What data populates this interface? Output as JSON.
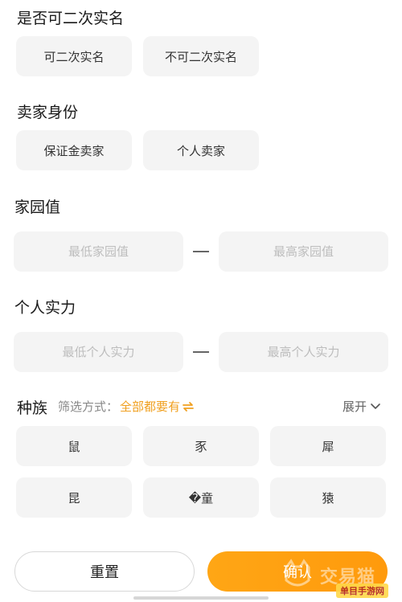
{
  "realname": {
    "title": "是否可二次实名",
    "options": [
      "可二次实名",
      "不可二次实名"
    ]
  },
  "seller": {
    "title": "卖家身份",
    "options": [
      "保证金卖家",
      "个人卖家"
    ]
  },
  "home_value": {
    "title": "家园值",
    "min_placeholder": "最低家园值",
    "max_placeholder": "最高家园值"
  },
  "power": {
    "title": "个人实力",
    "min_placeholder": "最低个人实力",
    "max_placeholder": "最高个人实力"
  },
  "race": {
    "title": "种族",
    "filter_label": "筛选方式：",
    "filter_value": "全部都要有",
    "expand_label": "展开",
    "options": [
      "鼠",
      "豕",
      "犀",
      "昆",
      "�童",
      "猿"
    ]
  },
  "footer": {
    "reset_label": "重置",
    "confirm_label": "确认"
  },
  "watermark": {
    "text": "交易猫",
    "badge": "单目手游网"
  },
  "colors": {
    "accent": "#ffa615",
    "chip_bg": "#f4f4f4"
  },
  "icons": [
    "swap-icon",
    "chevron-down-icon",
    "watermark-logo-icon"
  ]
}
